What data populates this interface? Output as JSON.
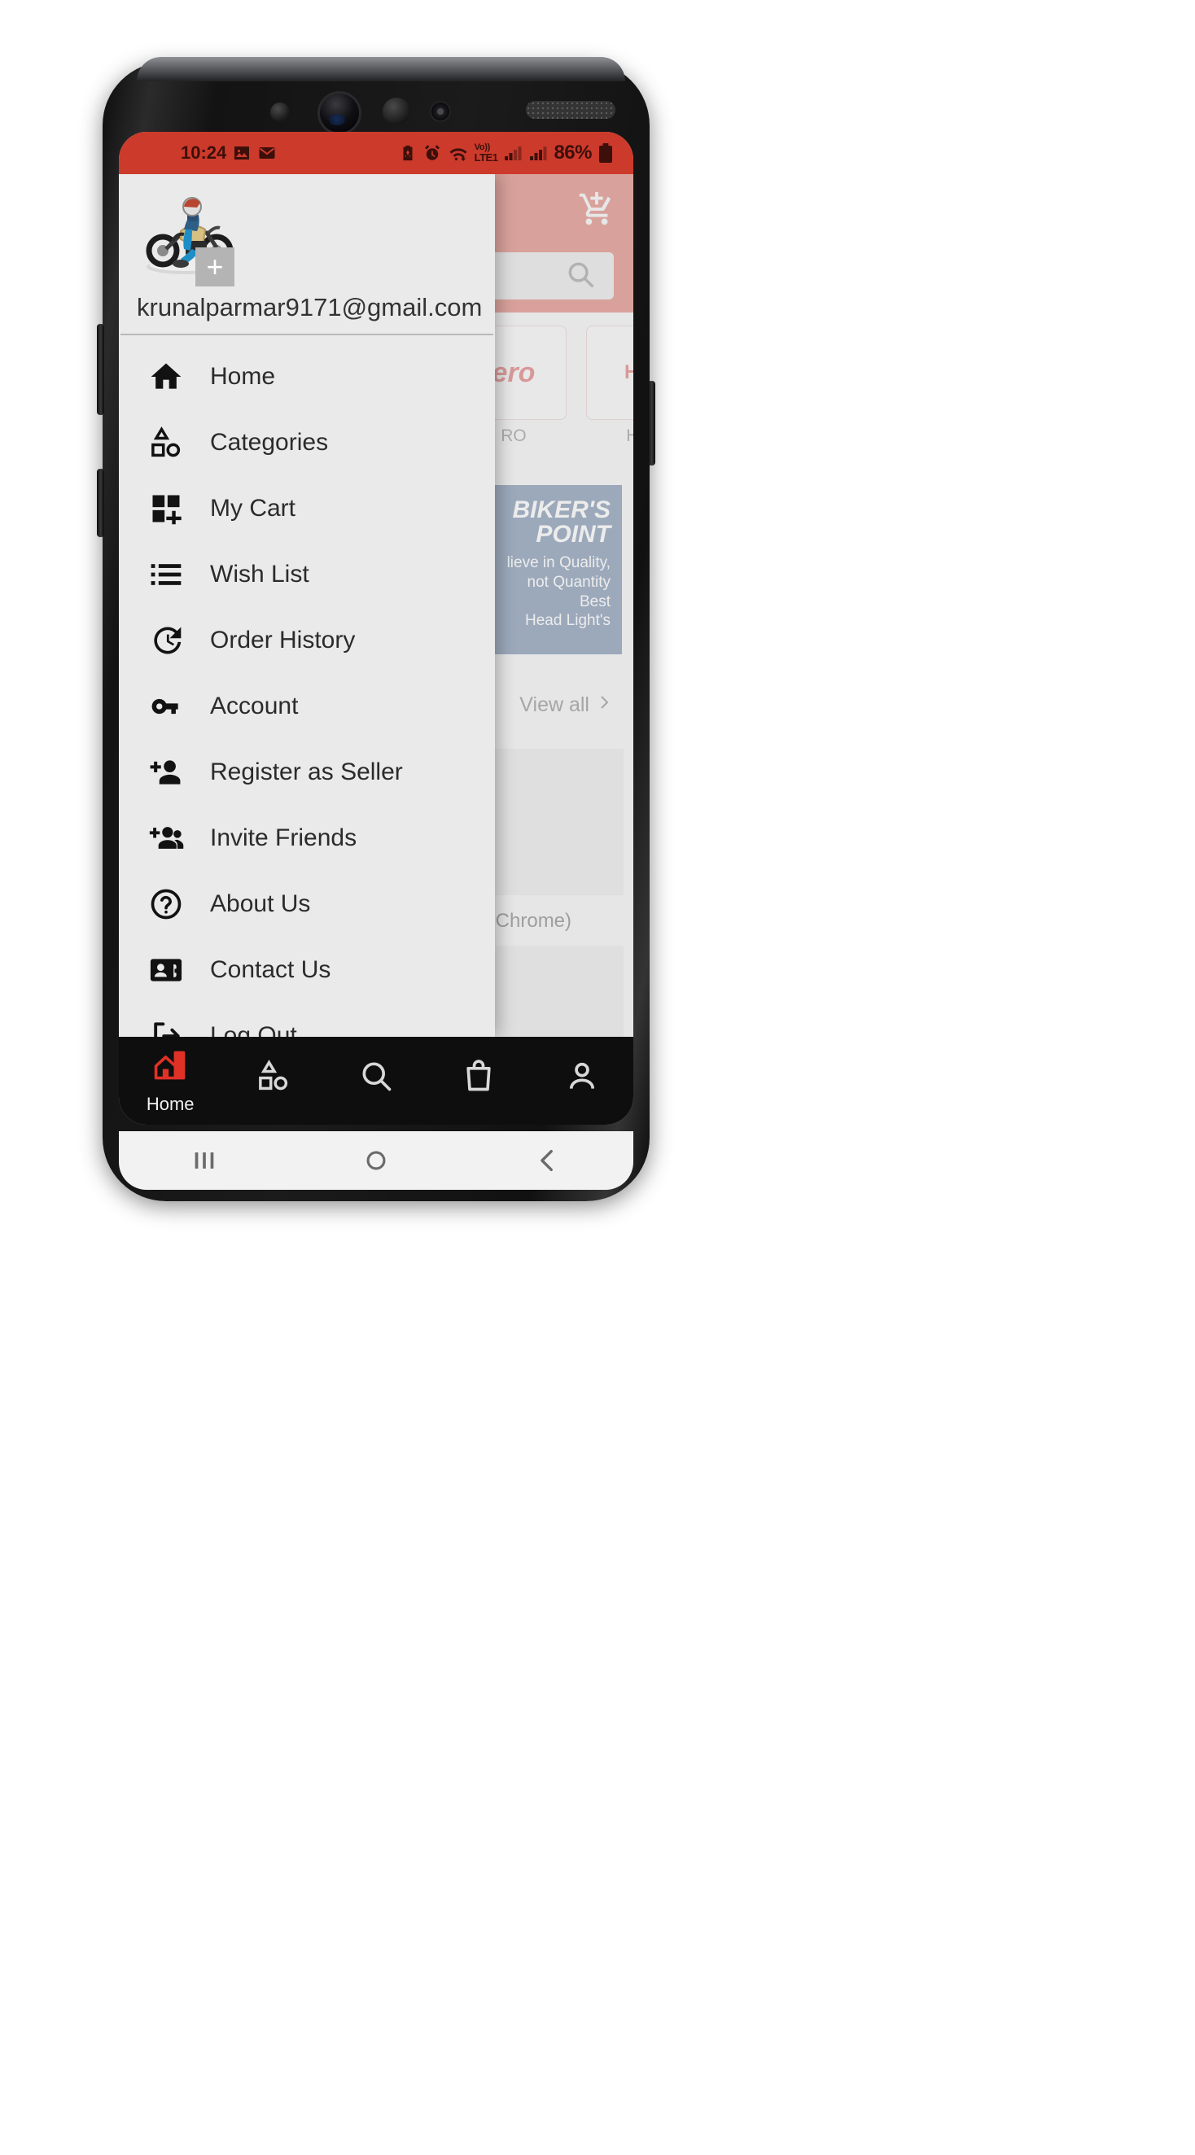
{
  "status_bar": {
    "time": "10:24",
    "left_icons": [
      "image-icon",
      "mail-icon"
    ],
    "right_icons": [
      "battery-saver-icon",
      "alarm-icon",
      "wifi-icon",
      "signal-icon",
      "signal-icon"
    ],
    "volte_line1": "Vo))",
    "volte_line2": "LTE1",
    "battery_percent": "86%",
    "bg_color": "#cc3a2c"
  },
  "drawer": {
    "avatar_alt": "motorcycle-rider-avatar",
    "avatar_badge": "+",
    "email": "krunalparmar9171@gmail.com",
    "items": [
      {
        "label": "Home",
        "icon": "home-icon"
      },
      {
        "label": "Categories",
        "icon": "shapes-icon"
      },
      {
        "label": "My Cart",
        "icon": "grid-plus-icon"
      },
      {
        "label": "Wish List",
        "icon": "list-icon"
      },
      {
        "label": "Order History",
        "icon": "history-icon"
      },
      {
        "label": "Account",
        "icon": "key-icon"
      },
      {
        "label": "Register as Seller",
        "icon": "person-add-icon"
      },
      {
        "label": "Invite Friends",
        "icon": "people-add-icon"
      },
      {
        "label": "About Us",
        "icon": "help-circle-icon"
      },
      {
        "label": "Contact Us",
        "icon": "contact-card-icon"
      },
      {
        "label": "Log Out",
        "icon": "logout-icon"
      }
    ]
  },
  "app_background": {
    "header_color": "#cc3a2c",
    "cart_icon": "add-to-cart-icon",
    "search_icon": "search-icon",
    "brands": [
      {
        "logo_text": "ero",
        "label": "RO"
      },
      {
        "logo_text": "HO",
        "label": "HO"
      }
    ],
    "promo": {
      "title": "BIKER'S POINT",
      "line1": "lieve in Quality,",
      "line2": "not Quantity",
      "line3": "Best",
      "line4": "Head Light's"
    },
    "view_all": "View all",
    "view_all_icon": "chevron-right-icon",
    "product_label": "B (Chrome)"
  },
  "bottom_nav": {
    "items": [
      {
        "label": "Home",
        "icon": "home-store-icon",
        "active": true
      },
      {
        "label": "",
        "icon": "shapes-icon",
        "active": false
      },
      {
        "label": "",
        "icon": "search-icon",
        "active": false
      },
      {
        "label": "",
        "icon": "bag-icon",
        "active": false
      },
      {
        "label": "",
        "icon": "person-icon",
        "active": false
      }
    ],
    "active_color": "#e03127"
  },
  "system_nav": {
    "recents": "recents-icon",
    "home": "home-circle-icon",
    "back": "back-icon"
  }
}
